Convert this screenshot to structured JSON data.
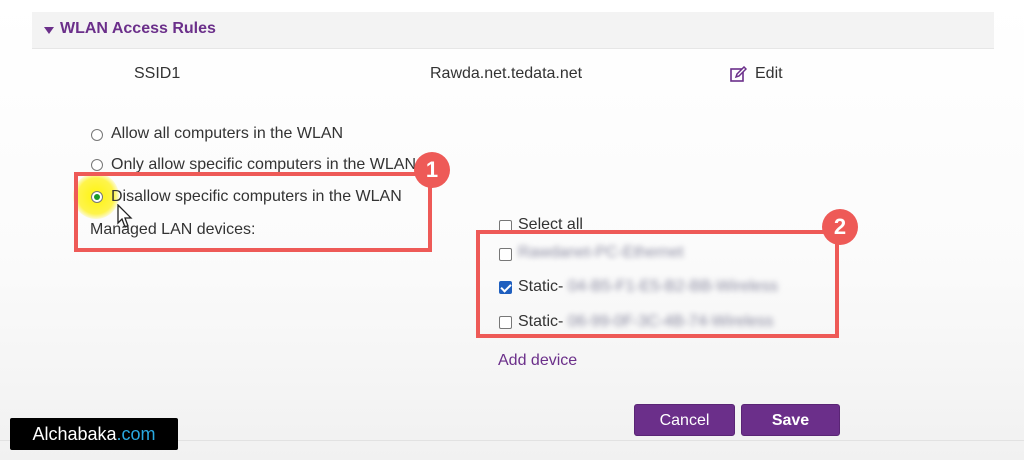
{
  "section": {
    "title": "WLAN Access Rules"
  },
  "ssid_row": {
    "label": "SSID1",
    "value": "Rawda.net.tedata.net",
    "edit_label": "Edit"
  },
  "rules": {
    "options": [
      {
        "label": "Allow all computers in the WLAN",
        "checked": false
      },
      {
        "label": "Only allow specific computers in the WLAN",
        "checked": false
      },
      {
        "label": "Disallow specific computers in the WLAN",
        "checked": true
      }
    ],
    "managed_label": "Managed LAN devices:"
  },
  "devices": {
    "select_all_label": "Select all",
    "items": [
      {
        "prefix": "",
        "masked": "Rawdanet-PC-Ethernet",
        "checked": false
      },
      {
        "prefix": "Static-",
        "masked": "04-B5-F1-E5-B2-BB-Wireless",
        "checked": true
      },
      {
        "prefix": "Static-",
        "masked": "06-99-0F-3C-4B-74-Wireless",
        "checked": false
      }
    ],
    "add_label": "Add device"
  },
  "annotations": {
    "badge1": "1",
    "badge2": "2"
  },
  "buttons": {
    "cancel": "Cancel",
    "save": "Save"
  },
  "brand": {
    "name": "Alchabaka",
    "tld": ".com"
  },
  "colors": {
    "accent": "#6b2f8a",
    "annotation": "#ee5a57",
    "checkbox": "#1f5fbf"
  }
}
